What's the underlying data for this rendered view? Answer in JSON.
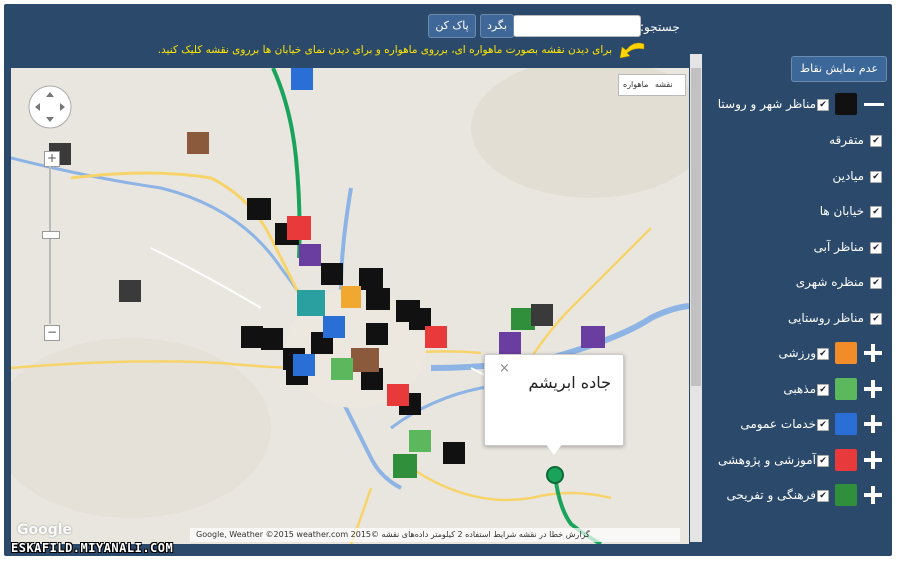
{
  "search": {
    "label": "جستجو:",
    "back_label": "بگرد",
    "clear_label": "پاک کن"
  },
  "hint": "برای دیدن نقشه بصورت ماهواره ای، برروی ماهواره و برای دیدن نمای خیابان ها برروی نقشه کلیک کنید.",
  "hide_points_label": "عدم نمایش نقاط",
  "layers": [
    {
      "label": "مناظر شهر و روستا",
      "checked": true,
      "icon": "camera-icon",
      "expand": "minus"
    },
    {
      "label": "متفرقه",
      "checked": true
    },
    {
      "label": "میادین",
      "checked": true
    },
    {
      "label": "خیابان ها",
      "checked": true
    },
    {
      "label": "مناظر آبی",
      "checked": true
    },
    {
      "label": "منظره شهری",
      "checked": true
    },
    {
      "label": "مناظر روستایی",
      "checked": true
    },
    {
      "label": "ورزشی",
      "checked": true,
      "icon": "sports-icon",
      "color": "#f28c28",
      "expand": "plus"
    },
    {
      "label": "مذهبی",
      "checked": true,
      "icon": "mosque-icon",
      "color": "#5cb85c",
      "expand": "plus"
    },
    {
      "label": "خدمات عمومی",
      "checked": true,
      "icon": "mail-icon",
      "color": "#2a6fd6",
      "expand": "plus"
    },
    {
      "label": "آموزشی و پژوهشی",
      "checked": true,
      "icon": "school-icon",
      "color": "#e8393b",
      "expand": "plus"
    },
    {
      "label": "فرهنگی و تفریحی",
      "checked": true,
      "icon": "tree-icon",
      "color": "#2f8f3a",
      "expand": "plus"
    }
  ],
  "map": {
    "type_map": "نقشه",
    "type_satellite": "ماهواره",
    "popup_title": "جاده ابریشم",
    "popup_close": "×",
    "footer": "گزارش خطا در نقشه   شرایط استفاده   2 کیلومتر   داده‌های نقشه ©2015 Google, Weather ©2015 weather.com",
    "google_logo": "Google"
  },
  "watermark": "ESKAFILD.MIYANALI.COM"
}
